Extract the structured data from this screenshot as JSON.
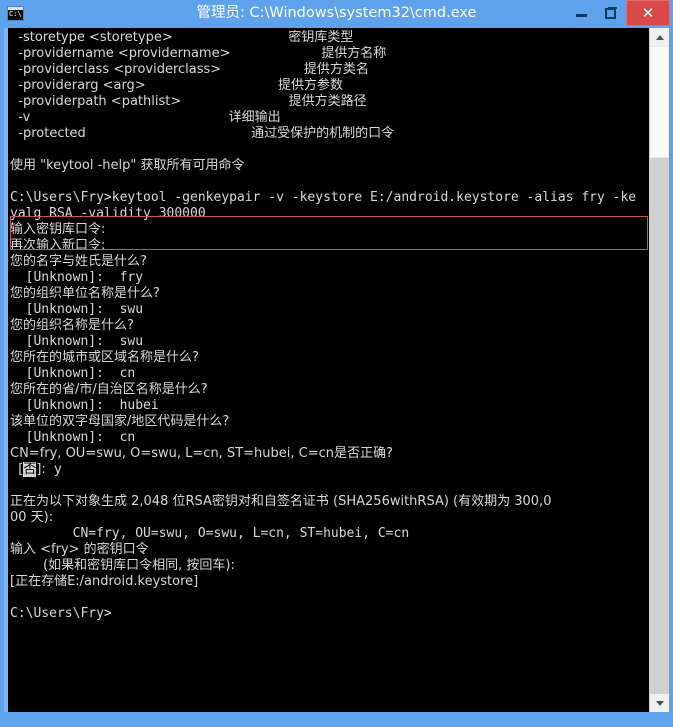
{
  "window": {
    "title": "管理员: C:\\Windows\\system32\\cmd.exe",
    "icon_label": "C:\\",
    "minimize_label": "—",
    "maximize_label": "❐",
    "close_label": "✕",
    "frame_color": "#5ea2ec",
    "close_button_color": "#d84a4a",
    "console_background": "#000000",
    "console_foreground": "#d8d8d8"
  },
  "highlight": {
    "color": "#c05a5a",
    "target_text": "C:\\Users\\Fry>keytool -genkeypair -v -keystore E:/android.keystore -alias fry -keyalg RSA -validity 300000"
  },
  "scrollbar": {
    "up_arrow": "▲",
    "down_arrow": "▼",
    "orientation": "vertical"
  },
  "console": {
    "help_options": [
      {
        "flag": "-storetype <storetype>",
        "desc": "密钥库类型"
      },
      {
        "flag": "-providername <providername>",
        "desc": "提供方名称"
      },
      {
        "flag": "-providerclass <providerclass>",
        "desc": "提供方类名"
      },
      {
        "flag": "-providerarg <arg>",
        "desc": "提供方参数"
      },
      {
        "flag": "-providerpath <pathlist>",
        "desc": "提供方类路径"
      },
      {
        "flag": "-v",
        "desc": "详细输出"
      },
      {
        "flag": "-protected",
        "desc": "通过受保护的机制的口令"
      }
    ],
    "lines": [
      {
        "id": "opt0",
        "text": "  -storetype <storetype>                            密钥库类型"
      },
      {
        "id": "opt1",
        "text": "  -providername <providername>                      提供方名称"
      },
      {
        "id": "opt2",
        "text": "  -providerclass <providerclass>                    提供方类名"
      },
      {
        "id": "opt3",
        "text": "  -providerarg <arg>                                提供方参数"
      },
      {
        "id": "opt4",
        "text": "  -providerpath <pathlist>                          提供方类路径"
      },
      {
        "id": "opt5",
        "text": "  -v                                                详细输出"
      },
      {
        "id": "opt6",
        "text": "  -protected                                        通过受保护的机制的口令"
      },
      {
        "id": "blank1",
        "text": ""
      },
      {
        "id": "helphint",
        "text": "使用 \"keytool -help\" 获取所有可用命令"
      },
      {
        "id": "blank2",
        "text": ""
      },
      {
        "id": "cmd1",
        "text": "C:\\Users\\Fry>keytool -genkeypair -v -keystore E:/android.keystore -alias fry -ke"
      },
      {
        "id": "cmd2",
        "text": "yalg RSA -validity 300000"
      },
      {
        "id": "p1",
        "text": "输入密钥库口令:"
      },
      {
        "id": "p2",
        "text": "再次输入新口令:"
      },
      {
        "id": "q1",
        "text": "您的名字与姓氏是什么?"
      },
      {
        "id": "a1",
        "text": "  [Unknown]:  fry"
      },
      {
        "id": "q2",
        "text": "您的组织单位名称是什么?"
      },
      {
        "id": "a2",
        "text": "  [Unknown]:  swu"
      },
      {
        "id": "q3",
        "text": "您的组织名称是什么?"
      },
      {
        "id": "a3",
        "text": "  [Unknown]:  swu"
      },
      {
        "id": "q4",
        "text": "您所在的城市或区域名称是什么?"
      },
      {
        "id": "a4",
        "text": "  [Unknown]:  cn"
      },
      {
        "id": "q5",
        "text": "您所在的省/市/自治区名称是什么?"
      },
      {
        "id": "a5",
        "text": "  [Unknown]:  hubei"
      },
      {
        "id": "q6",
        "text": "该单位的双字母国家/地区代码是什么?"
      },
      {
        "id": "a6",
        "text": "  [Unknown]:  cn"
      },
      {
        "id": "dnconfirm",
        "text": "CN=fry, OU=swu, O=swu, L=cn, ST=hubei, C=cn是否正确?"
      },
      {
        "id": "dnanswer",
        "text": "  [否]:  y"
      },
      {
        "id": "blank3",
        "text": ""
      },
      {
        "id": "gen1",
        "text": "正在为以下对象生成 2,048 位RSA密钥对和自签名证书 (SHA256withRSA) (有效期为 300,0"
      },
      {
        "id": "gen2",
        "text": "00 天):"
      },
      {
        "id": "gendn",
        "text": "        CN=fry, OU=swu, O=swu, L=cn, ST=hubei, C=cn"
      },
      {
        "id": "keypw1",
        "text": "输入 <fry> 的密钥口令"
      },
      {
        "id": "keypw2",
        "text": "        (如果和密钥库口令相同, 按回车):"
      },
      {
        "id": "storing",
        "text": "[正在存储E:/android.keystore]"
      },
      {
        "id": "blank4",
        "text": ""
      },
      {
        "id": "prompt",
        "text": "C:\\Users\\Fry>"
      }
    ],
    "dn_answer_highlight": "否",
    "final_prompt": "C:\\Users\\Fry>"
  }
}
